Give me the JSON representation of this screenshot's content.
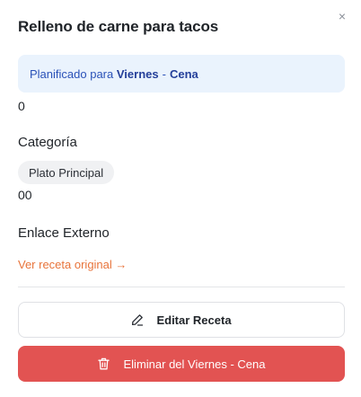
{
  "modal": {
    "close_glyph": "×",
    "title": "Relleno de carne para tacos"
  },
  "plan": {
    "prefix": "Planificado para",
    "day": "Viernes",
    "separator": "-",
    "meal": "Cena"
  },
  "values": {
    "first": "0",
    "second": "00"
  },
  "category": {
    "label": "Categoría",
    "chip": "Plato Principal"
  },
  "external_link": {
    "label": "Enlace Externo",
    "link_text": "Ver receta original →"
  },
  "actions": {
    "edit_label": "Editar Receta",
    "edit_icon": "pencil-icon",
    "delete_label": "Eliminar del Viernes - Cena",
    "delete_icon": "trash-icon"
  },
  "colors": {
    "plan_background": "#eaf3fd",
    "plan_text": "#2a52b8",
    "link": "#e8743b",
    "danger": "#e25352"
  }
}
